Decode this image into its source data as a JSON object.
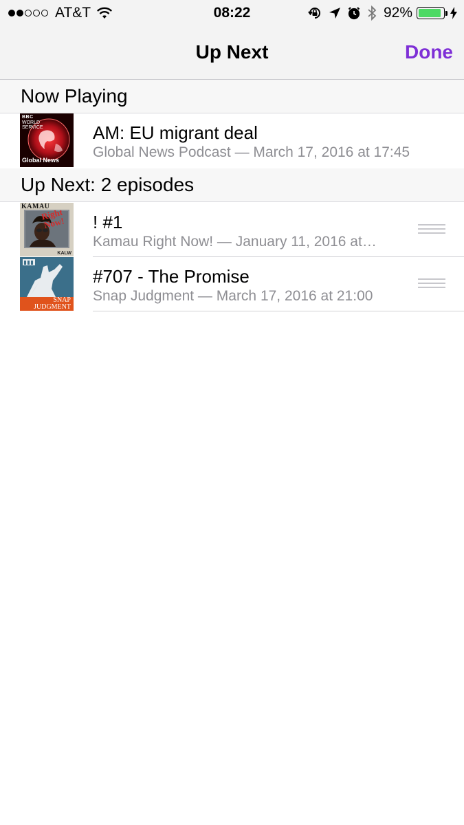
{
  "status_bar": {
    "carrier": "AT&T",
    "time": "08:22",
    "battery_percent": "92%",
    "battery_level": 0.92,
    "battery_color": "#4cd964",
    "icons": [
      "signal-dots-icon",
      "wifi-icon",
      "orientation-lock-icon",
      "location-arrow-icon",
      "alarm-icon",
      "bluetooth-icon",
      "battery-icon",
      "charging-bolt-icon"
    ]
  },
  "nav": {
    "title": "Up Next",
    "done_label": "Done",
    "accent_color": "#7e2fd6"
  },
  "now_playing": {
    "header": "Now Playing",
    "episode": {
      "title": "AM: EU migrant deal",
      "subtitle": "Global News Podcast — March 17, 2016 at 17:45",
      "artwork": {
        "icon": "bbc-world-service-artwork",
        "lines": [
          "BBC",
          "WORLD",
          "SERVICE"
        ],
        "caption": "Global News"
      }
    }
  },
  "up_next": {
    "header": "Up Next: 2 episodes",
    "episodes": [
      {
        "title": "! #1",
        "subtitle": "Kamau Right Now! — January 11, 2016 at…",
        "artwork": {
          "icon": "kamau-right-now-artwork",
          "top_text": "KAMAU",
          "overlay_text": "Right Now!",
          "caption": "KALW"
        }
      },
      {
        "title": "#707 - The Promise",
        "subtitle": "Snap Judgment — March 17, 2016 at 21:00",
        "artwork": {
          "icon": "snap-judgment-artwork",
          "caption_line1": "SNAP",
          "caption_line2": "JUDGMENT"
        }
      }
    ]
  }
}
